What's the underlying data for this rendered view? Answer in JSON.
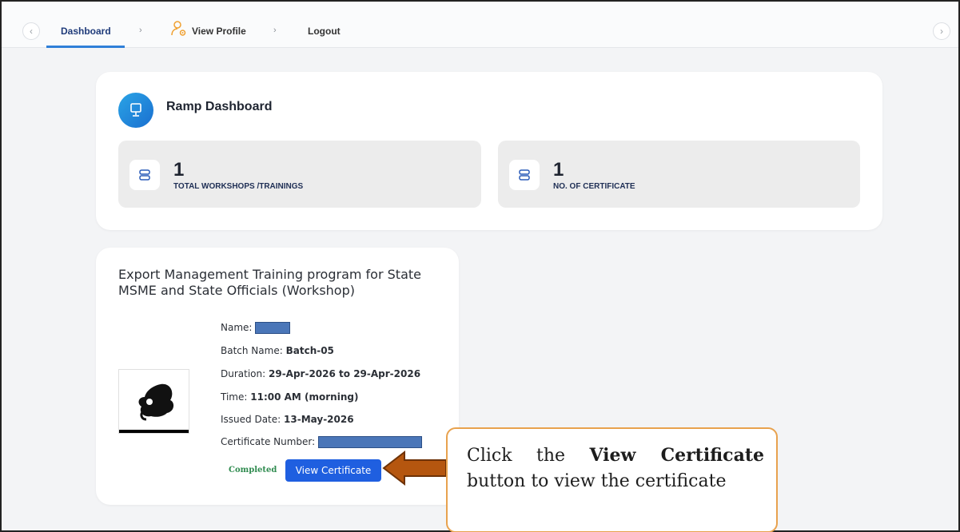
{
  "nav": {
    "tabs": [
      {
        "label": "Dashboard"
      },
      {
        "label": "View Profile"
      },
      {
        "label": "Logout"
      }
    ],
    "separator": "›",
    "left_arrow": "‹",
    "right_arrow": "›"
  },
  "dashboard": {
    "title": "Ramp Dashboard",
    "stats": [
      {
        "value": "1",
        "label": "TOTAL WORKSHOPS /TRAININGS",
        "icon": "server-icon"
      },
      {
        "value": "1",
        "label": "NO. OF CERTIFICATE",
        "icon": "server-icon"
      }
    ]
  },
  "training": {
    "title": "Export Management Training program for State MSME and State Officials (Workshop)",
    "name_label": "Name:",
    "batch_label": "Batch Name:",
    "batch_value": "Batch-05",
    "duration_label": "Duration:",
    "duration_value": "29-Apr-2026 to 29-Apr-2026",
    "time_label": "Time:",
    "time_value": "11:00 AM (morning)",
    "issued_label": "Issued Date:",
    "issued_value": "13-May-2026",
    "cert_label": "Certificate Number:",
    "status": "Completed",
    "button_label": "View Certificate"
  },
  "callout": {
    "text_pre": "Click the",
    "text_bold": "View Certificate",
    "text_post": "button to view the certificate"
  },
  "colors": {
    "accent": "#1f5fe0",
    "status_green": "#2f8b4f",
    "callout_border": "#e8a24e",
    "arrow": "#b5560f"
  }
}
